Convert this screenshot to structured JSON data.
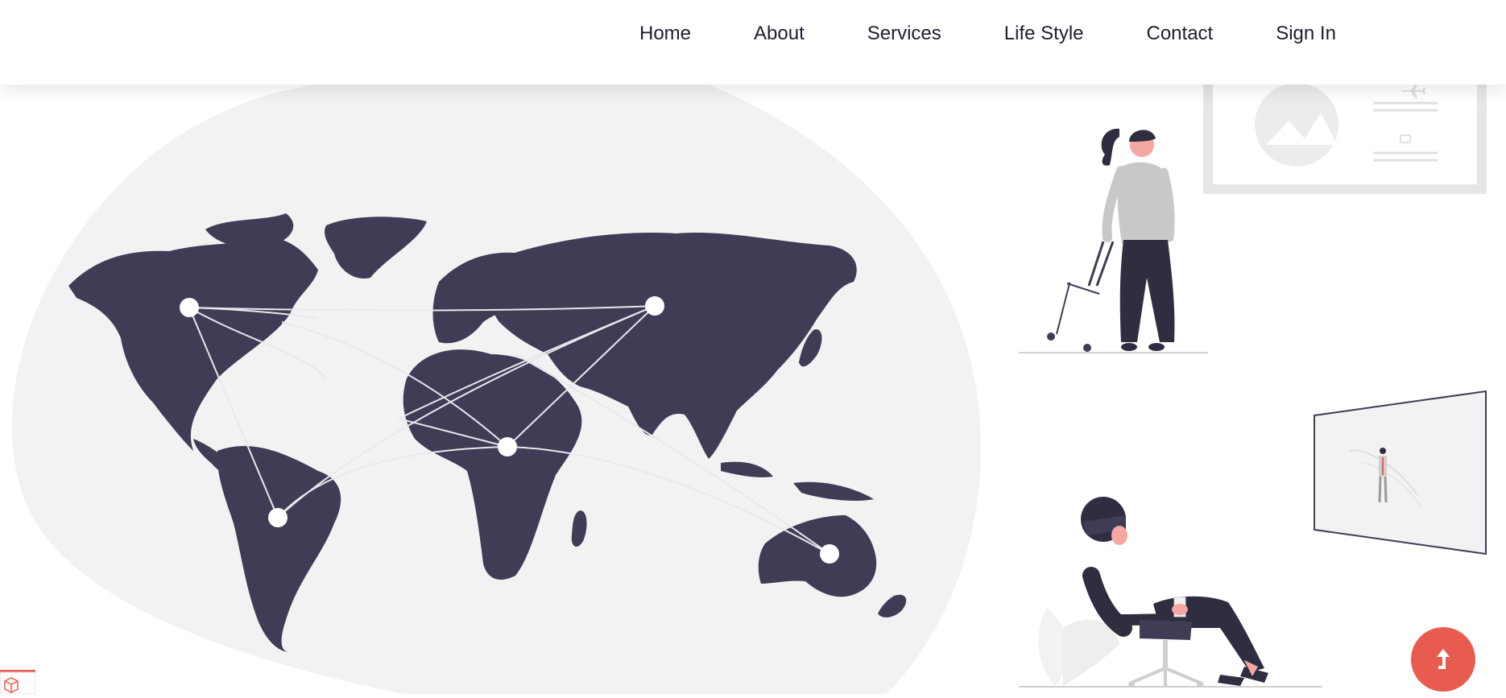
{
  "nav": {
    "items": [
      {
        "label": "Home"
      },
      {
        "label": "About"
      },
      {
        "label": "Services"
      },
      {
        "label": "Life Style"
      },
      {
        "label": "Contact"
      },
      {
        "label": "Sign In"
      }
    ]
  },
  "icons": {
    "scroll_top": "arrow-up-icon",
    "corner_badge": "box-icon",
    "plane": "plane-icon"
  },
  "colors": {
    "map": "#3f3d56",
    "blob": "#f2f2f2",
    "accent": "#e85c4f",
    "muted": "#e6e6e6"
  }
}
